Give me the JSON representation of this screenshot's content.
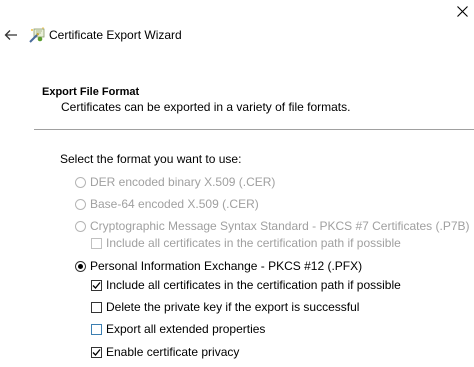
{
  "window": {
    "title": "Certificate Export Wizard"
  },
  "icons": {
    "close": "close-icon",
    "back": "back-arrow-icon",
    "wizard": "certificate-wizard-icon"
  },
  "section": {
    "title": "Export File Format",
    "description": "Certificates can be exported in a variety of file formats."
  },
  "prompt": "Select the format you want to use:",
  "options": {
    "der": {
      "label": "DER encoded binary X.509 (.CER)",
      "selected": false,
      "enabled": false
    },
    "base64": {
      "label": "Base-64 encoded X.509 (.CER)",
      "selected": false,
      "enabled": false
    },
    "p7b": {
      "label": "Cryptographic Message Syntax Standard - PKCS #7 Certificates (.P7B)",
      "selected": false,
      "enabled": false
    },
    "p7b_include_all": {
      "label": "Include all certificates in the certification path if possible",
      "checked": false,
      "enabled": false
    },
    "pfx": {
      "label": "Personal Information Exchange - PKCS #12 (.PFX)",
      "selected": true,
      "enabled": true
    },
    "pfx_include_all": {
      "label": "Include all certificates in the certification path if possible",
      "checked": true,
      "enabled": true
    },
    "delete_key": {
      "label": "Delete the private key if the export is successful",
      "checked": false,
      "enabled": true
    },
    "export_props": {
      "label": "Export all extended properties",
      "checked": false,
      "enabled": true
    },
    "cert_privacy": {
      "label": "Enable certificate privacy",
      "checked": true,
      "enabled": true
    }
  },
  "colors": {
    "disabled_text": "#a0a0a0",
    "divider": "#a0a0a0",
    "focus_border": "#3c7fb1"
  }
}
